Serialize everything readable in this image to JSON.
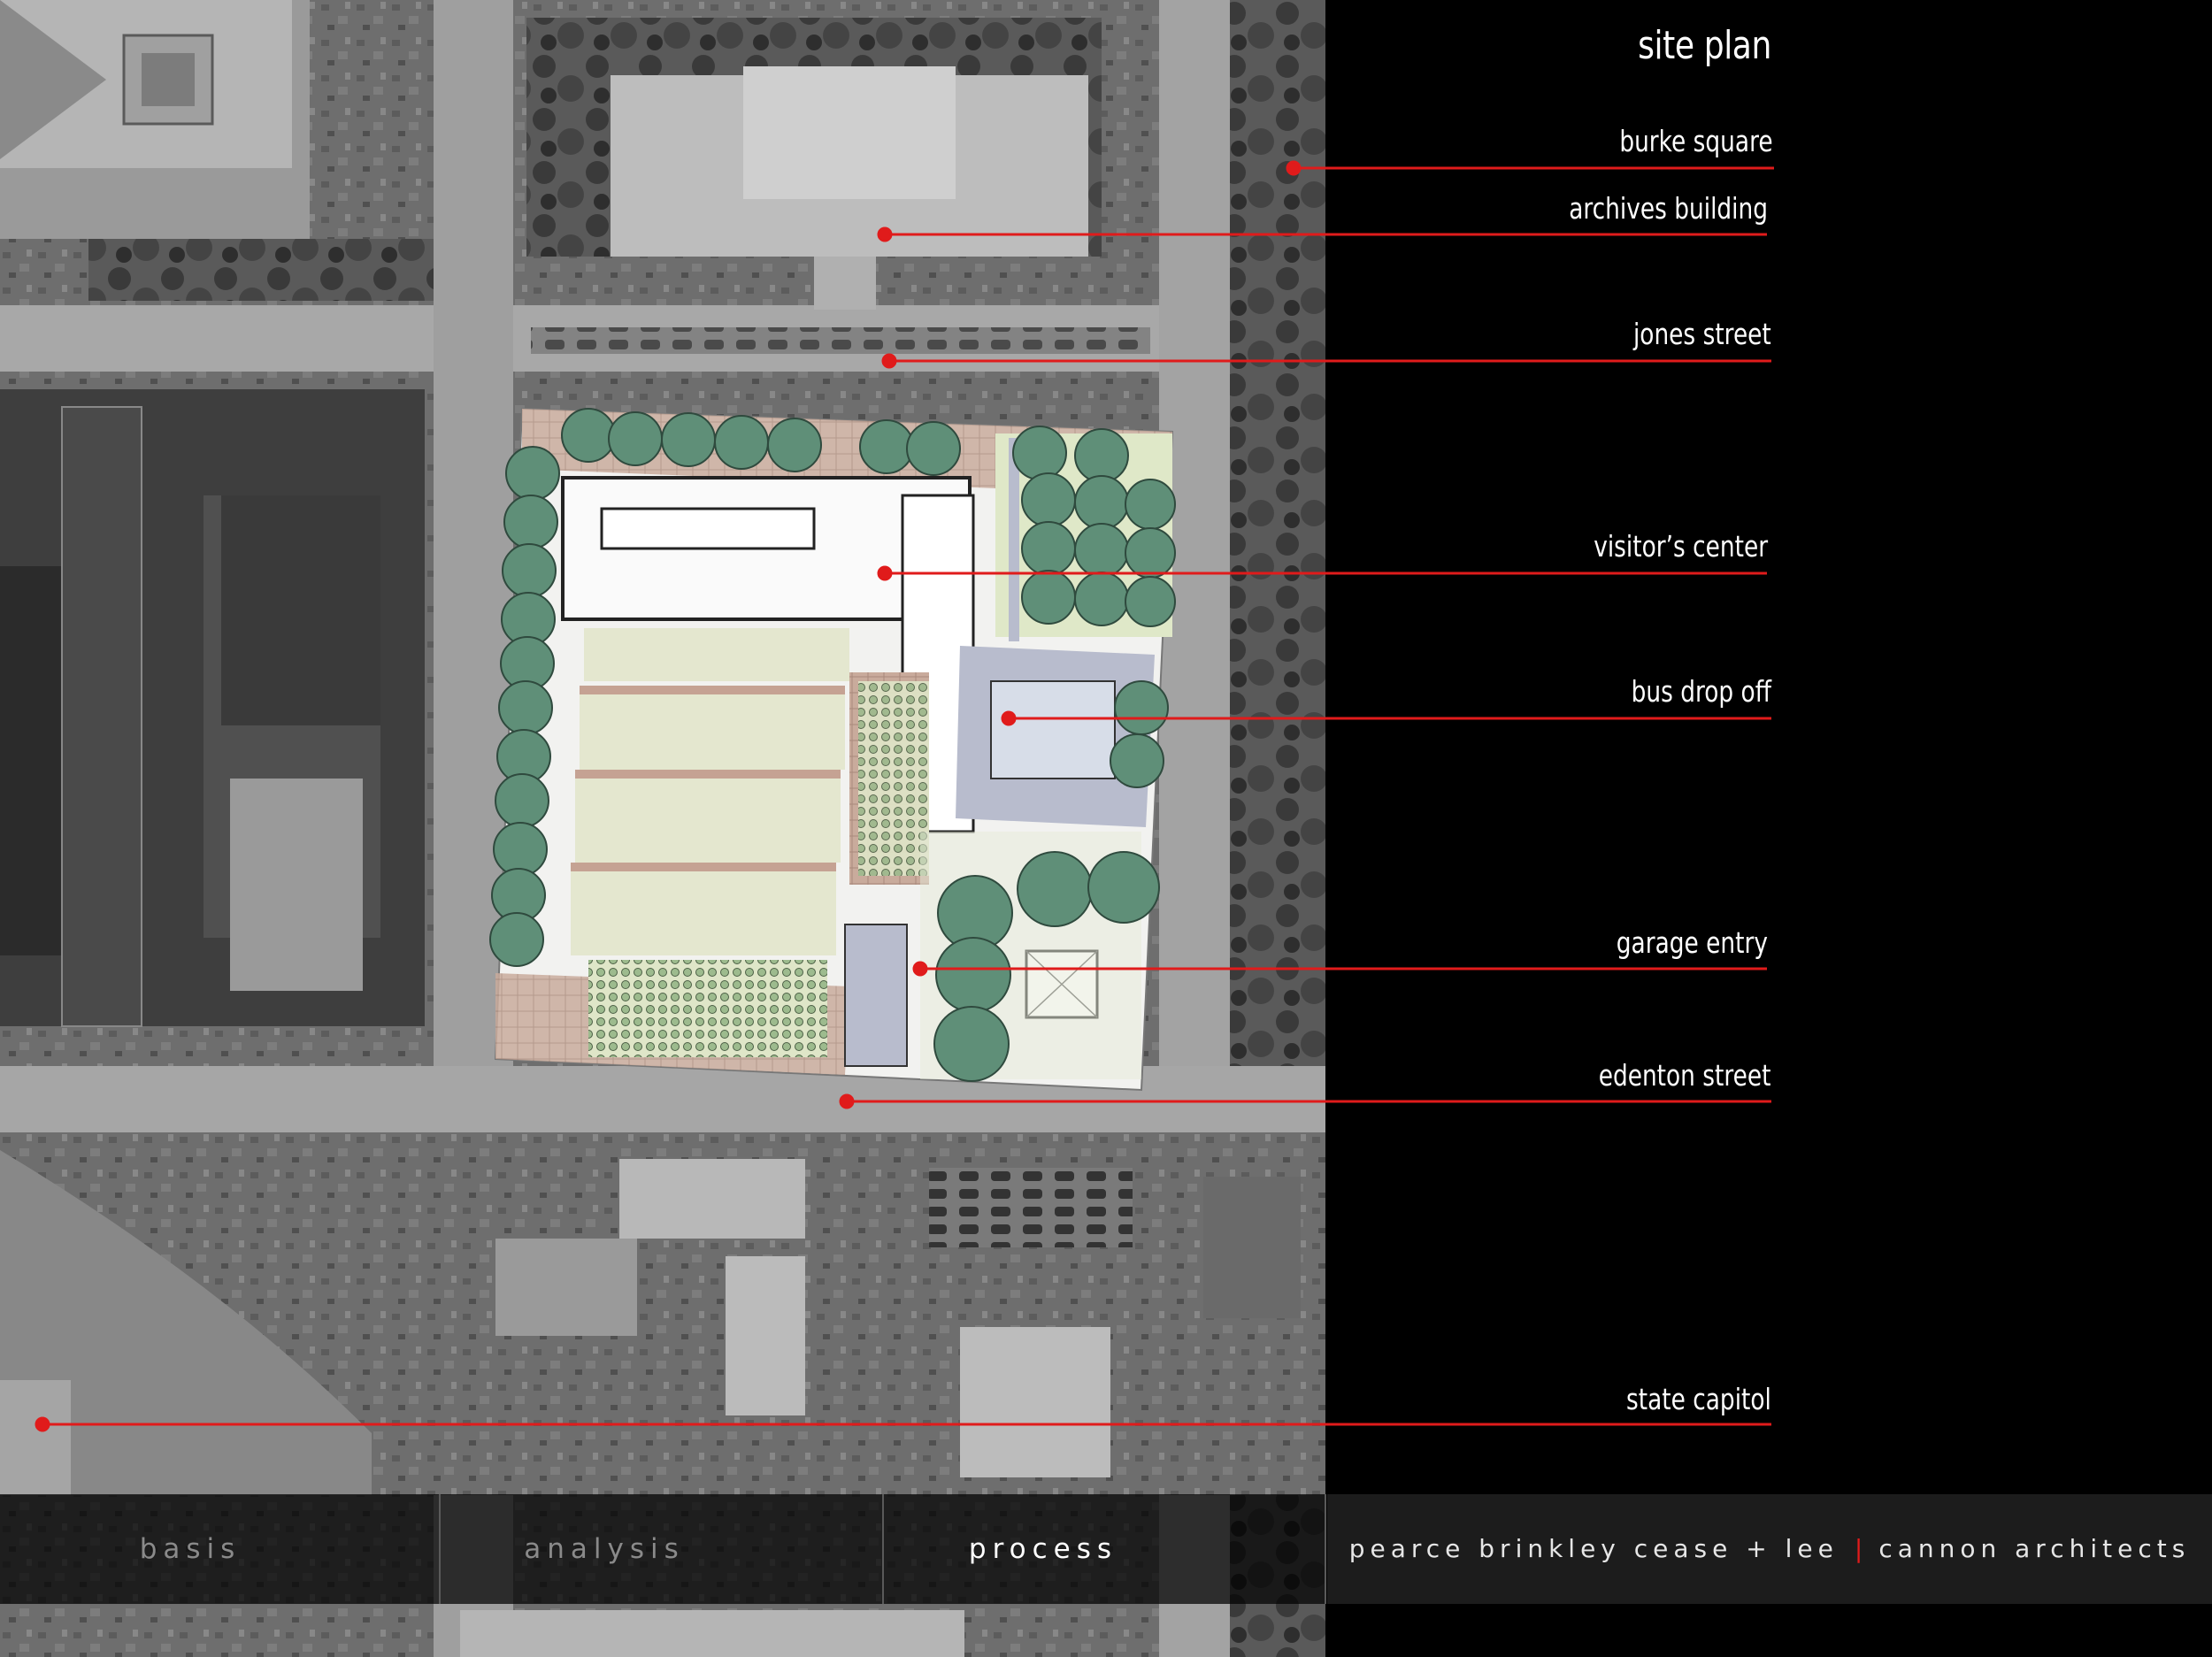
{
  "page": {
    "title": "site plan"
  },
  "labels": {
    "burke_square": "burke square",
    "archives_building": "archives building",
    "jones_street": "jones street",
    "visitors_center": "visitor’s center",
    "bus_drop_off": "bus drop off",
    "garage_entry": "garage entry",
    "edenton_street": "edenton street",
    "state_capitol": "state capitol"
  },
  "nav": {
    "basis": "basis",
    "analysis": "analysis",
    "process": "process",
    "active": "process"
  },
  "credits": {
    "firm_1": "pearce brinkley cease + lee",
    "separator": "|",
    "firm_2": "cannon architects"
  },
  "colors": {
    "accent": "#e01b1b",
    "background": "#000000",
    "text": "#ffffff",
    "nav_inactive": "#8a8a8a",
    "tree_green": "#5f8f78"
  }
}
